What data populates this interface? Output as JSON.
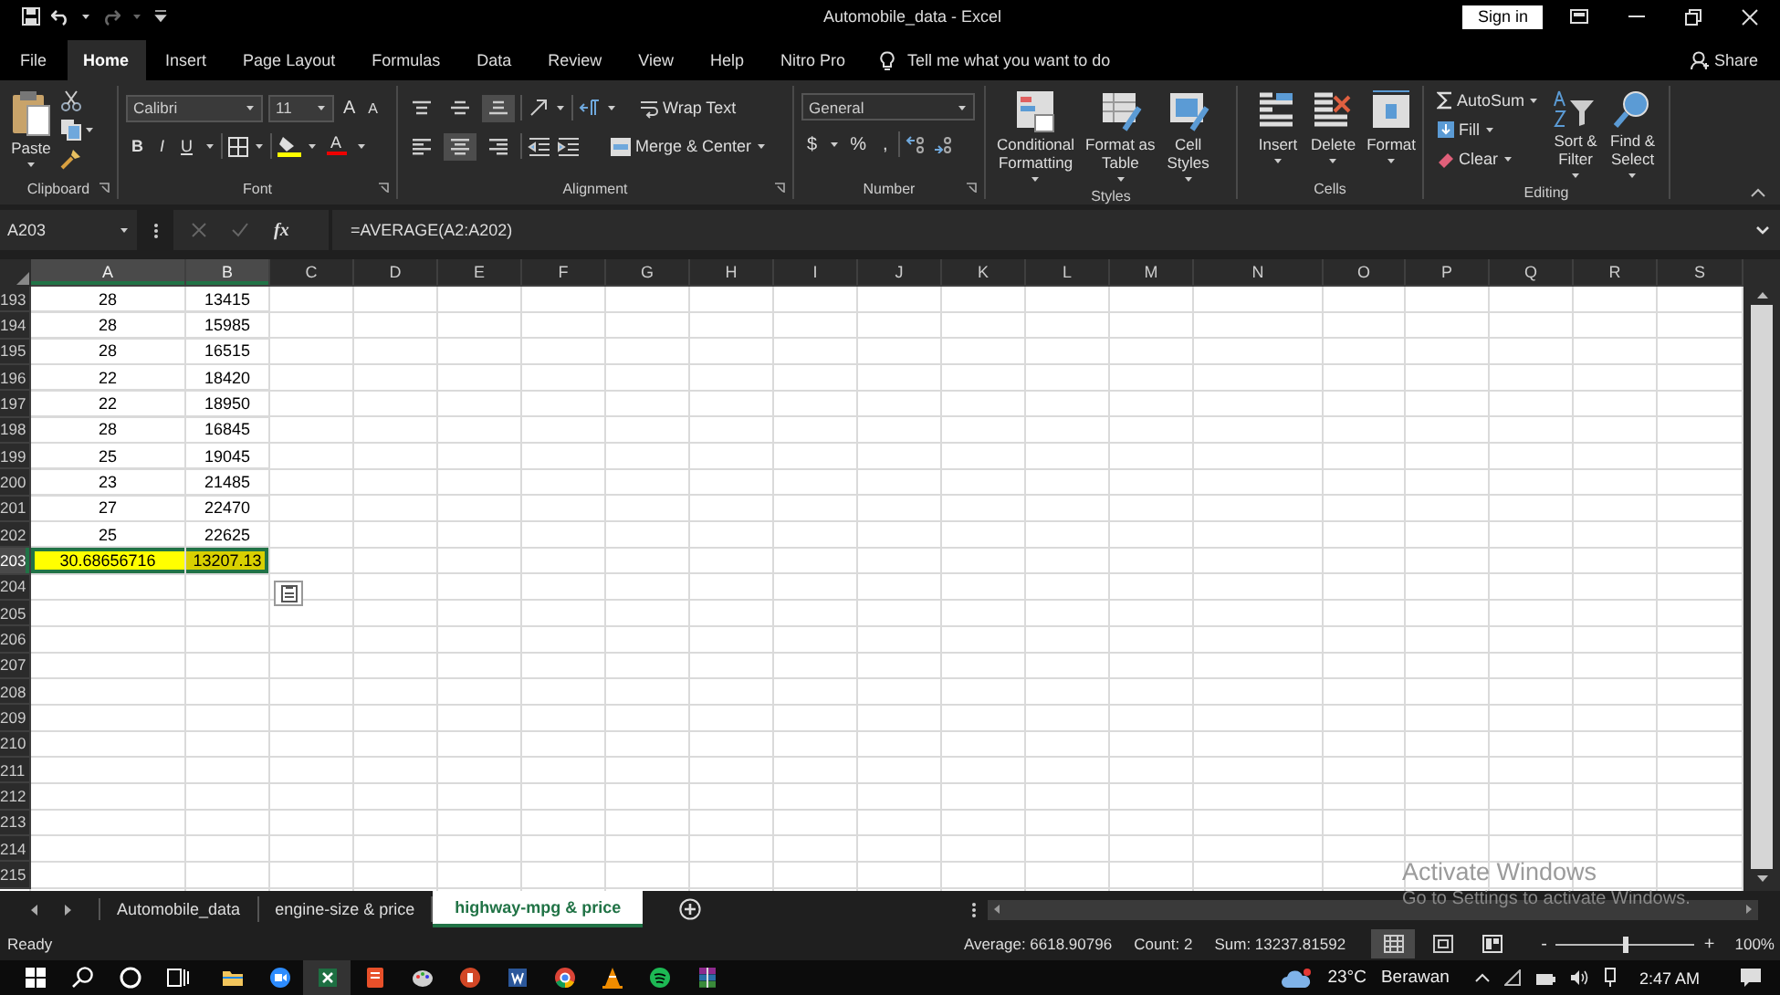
{
  "window": {
    "title": "Automobile_data - Excel",
    "sign_in": "Sign in"
  },
  "ribbon_tabs": [
    {
      "label": "File",
      "selected": false
    },
    {
      "label": "Home",
      "selected": true
    },
    {
      "label": "Insert",
      "selected": false
    },
    {
      "label": "Page Layout",
      "selected": false
    },
    {
      "label": "Formulas",
      "selected": false
    },
    {
      "label": "Data",
      "selected": false
    },
    {
      "label": "Review",
      "selected": false
    },
    {
      "label": "View",
      "selected": false
    },
    {
      "label": "Help",
      "selected": false
    },
    {
      "label": "Nitro Pro",
      "selected": false
    }
  ],
  "tell_me": "Tell me what you want to do",
  "share": "Share",
  "ribbon": {
    "clipboard": {
      "label": "Clipboard",
      "paste": "Paste"
    },
    "font": {
      "label": "Font",
      "name": "Calibri",
      "size": "11",
      "grow": "A",
      "shrink": "A",
      "bold": "B",
      "italic": "I",
      "underline": "U",
      "font_color": "A"
    },
    "alignment": {
      "label": "Alignment",
      "wrap_text": "Wrap Text",
      "merge_center": "Merge & Center",
      "vertical": [
        {
          "kind": "top",
          "selected": false
        },
        {
          "kind": "middle",
          "selected": false
        },
        {
          "kind": "bottom",
          "selected": true
        }
      ],
      "horizontal": [
        {
          "kind": "left",
          "selected": false
        },
        {
          "kind": "center",
          "selected": true
        },
        {
          "kind": "right",
          "selected": false
        }
      ]
    },
    "number": {
      "label": "Number",
      "format": "General",
      "currency": "$",
      "percent": "%",
      "comma": ","
    },
    "styles": {
      "label": "Styles",
      "buttons": [
        {
          "kind": "conditional",
          "label": "Conditional\nFormatting"
        },
        {
          "kind": "table",
          "label": "Format as\nTable"
        },
        {
          "kind": "cell",
          "label": "Cell\nStyles"
        }
      ]
    },
    "cells": {
      "label": "Cells",
      "buttons": [
        {
          "kind": "insert",
          "label": "Insert"
        },
        {
          "kind": "delete",
          "label": "Delete"
        },
        {
          "kind": "format",
          "label": "Format"
        }
      ]
    },
    "editing": {
      "label": "Editing",
      "autosum": "AutoSum",
      "fill": "Fill",
      "clear": "Clear",
      "sort_filter": "Sort &\nFilter",
      "find_select": "Find &\nSelect"
    }
  },
  "formula_bar": {
    "name_box": "A203",
    "function_label": "fx",
    "formula": "=AVERAGE(A2:A202)"
  },
  "sheet": {
    "columns": [
      {
        "label": "A",
        "selected": true
      },
      {
        "label": "B",
        "selected": true
      },
      {
        "label": "C",
        "selected": false
      },
      {
        "label": "D",
        "selected": false
      },
      {
        "label": "E",
        "selected": false
      },
      {
        "label": "F",
        "selected": false
      },
      {
        "label": "G",
        "selected": false
      },
      {
        "label": "H",
        "selected": false
      },
      {
        "label": "I",
        "selected": false
      },
      {
        "label": "J",
        "selected": false
      },
      {
        "label": "K",
        "selected": false
      },
      {
        "label": "L",
        "selected": false
      },
      {
        "label": "M",
        "selected": false
      },
      {
        "label": "N",
        "selected": false
      },
      {
        "label": "O",
        "selected": false
      },
      {
        "label": "P",
        "selected": false
      },
      {
        "label": "Q",
        "selected": false
      },
      {
        "label": "R",
        "selected": false
      },
      {
        "label": "S",
        "selected": false
      }
    ],
    "rows": [
      {
        "header": "193",
        "cells": [
          "28",
          "13415"
        ],
        "selected": false,
        "highlighted": false
      },
      {
        "header": "194",
        "cells": [
          "28",
          "15985"
        ],
        "selected": false,
        "highlighted": false
      },
      {
        "header": "195",
        "cells": [
          "28",
          "16515"
        ],
        "selected": false,
        "highlighted": false
      },
      {
        "header": "196",
        "cells": [
          "22",
          "18420"
        ],
        "selected": false,
        "highlighted": false
      },
      {
        "header": "197",
        "cells": [
          "22",
          "18950"
        ],
        "selected": false,
        "highlighted": false
      },
      {
        "header": "198",
        "cells": [
          "28",
          "16845"
        ],
        "selected": false,
        "highlighted": false
      },
      {
        "header": "199",
        "cells": [
          "25",
          "19045"
        ],
        "selected": false,
        "highlighted": false
      },
      {
        "header": "200",
        "cells": [
          "23",
          "21485"
        ],
        "selected": false,
        "highlighted": false
      },
      {
        "header": "201",
        "cells": [
          "27",
          "22470"
        ],
        "selected": false,
        "highlighted": false
      },
      {
        "header": "202",
        "cells": [
          "25",
          "22625"
        ],
        "selected": false,
        "highlighted": false
      },
      {
        "header": "203",
        "cells": [
          "30.68656716",
          "13207.13"
        ],
        "selected": true,
        "highlighted": true
      },
      {
        "header": "204",
        "selected": false,
        "highlighted": false
      },
      {
        "header": "205",
        "selected": false,
        "highlighted": false
      },
      {
        "header": "206",
        "selected": false,
        "highlighted": false
      },
      {
        "header": "207",
        "selected": false,
        "highlighted": false
      },
      {
        "header": "208",
        "selected": false,
        "highlighted": false
      },
      {
        "header": "209",
        "selected": false,
        "highlighted": false
      },
      {
        "header": "210",
        "selected": false,
        "highlighted": false
      },
      {
        "header": "211",
        "selected": false,
        "highlighted": false
      },
      {
        "header": "212",
        "selected": false,
        "highlighted": false
      },
      {
        "header": "213",
        "selected": false,
        "highlighted": false
      },
      {
        "header": "214",
        "selected": false,
        "highlighted": false
      },
      {
        "header": "215",
        "selected": false,
        "highlighted": false
      }
    ]
  },
  "sheet_tabs": [
    {
      "label": "Automobile_data",
      "selected": false
    },
    {
      "label": "engine-size & price",
      "selected": false
    },
    {
      "label": "highway-mpg & price",
      "selected": true
    }
  ],
  "status_bar": {
    "mode": "Ready",
    "average": "Average: 6618.90796",
    "count": "Count: 2",
    "sum": "Sum: 13237.81592",
    "views": [
      {
        "kind": "normal",
        "selected": true
      },
      {
        "kind": "page-layout",
        "selected": false
      },
      {
        "kind": "page-break",
        "selected": false
      }
    ],
    "zoom_minus": "-",
    "zoom_plus": "+",
    "zoom": {
      "level": 0.5
    },
    "zoom_label": "100%"
  },
  "activation_notice": [
    "Activate Windows",
    "Go to Settings to activate Windows."
  ],
  "taskbar": {
    "temperature": "23°C",
    "weather": "Berawan",
    "time": "2:47 AM"
  }
}
